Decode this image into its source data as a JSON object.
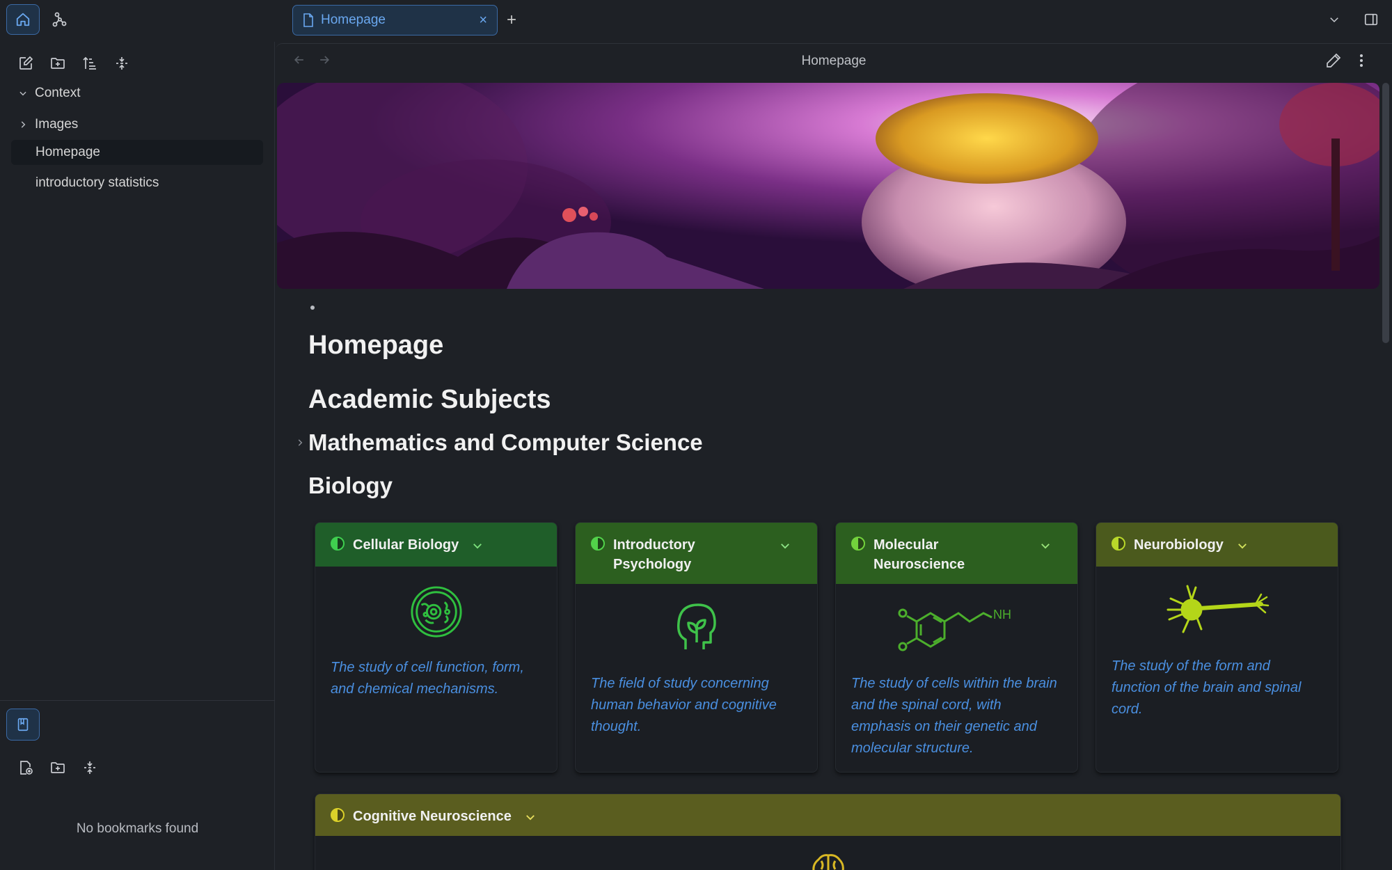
{
  "tabs": [
    {
      "label": "Homepage",
      "active": true
    }
  ],
  "sidebar": {
    "tree": [
      {
        "label": "Context",
        "type": "folder",
        "expanded": true
      },
      {
        "label": "Images",
        "type": "folder",
        "expanded": false
      },
      {
        "label": "Homepage",
        "type": "file",
        "active": true
      },
      {
        "label": "introductory statistics",
        "type": "file",
        "active": false
      }
    ],
    "bookmarks_empty": "No bookmarks found"
  },
  "view": {
    "title": "Homepage"
  },
  "note": {
    "h_homepage": "Homepage",
    "h_academic": "Academic Subjects",
    "h_math": "Mathematics and Computer Science",
    "h_bio": "Biology"
  },
  "cards": [
    {
      "title": "Cellular Biology",
      "description": "The study of cell function, form, and chemical mechanisms.",
      "icon": "cell-icon",
      "color": "#1f5e29",
      "indicator": "#3fcf4f"
    },
    {
      "title": "Introductory Psychology",
      "description": "The field of study concerning human behavior and cognitive thought.",
      "icon": "head-plant-icon",
      "color": "#2c5f1f",
      "indicator": "#52d24a"
    },
    {
      "title": "Molecular Neuroscience",
      "description": "The study of cells within the brain and the spinal cord, with emphasis on their genetic and molecular structure.",
      "icon": "dopamine-molecule-icon",
      "molecule_label": "NH",
      "color": "#2c5f1f",
      "indicator": "#73d23c"
    },
    {
      "title": "Neurobiology",
      "description": "The study of the form and function of the brain and spinal cord.",
      "icon": "neuron-icon",
      "color": "#4b5a1d",
      "indicator": "#b9d82a"
    },
    {
      "title": "Cognitive Neuroscience",
      "icon": "brain-icon",
      "color": "#5a5d1f",
      "indicator": "#dbd12a"
    }
  ],
  "colors": {
    "accent": "#3b6aa5",
    "link": "#4a8fe0",
    "background": "#1e2126"
  }
}
